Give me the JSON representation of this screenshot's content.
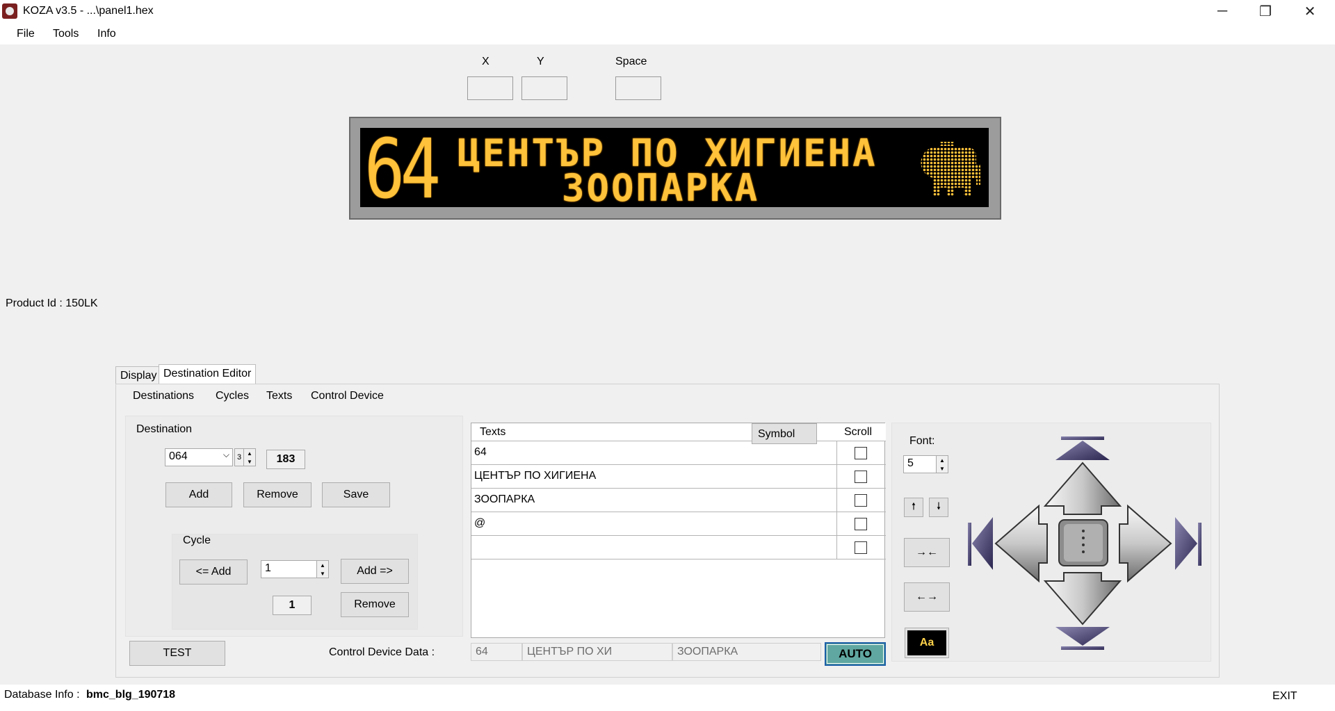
{
  "window": {
    "title": "KOZA  v3.5 - ...\\panel1.hex",
    "minimize": "─",
    "restore": "❐",
    "close": "✕"
  },
  "menu": [
    "File",
    "Tools",
    "Info"
  ],
  "coords": {
    "x_label": "X",
    "y_label": "Y",
    "space_label": "Space",
    "x_value": "",
    "y_value": "",
    "space_value": ""
  },
  "led": {
    "route": "64",
    "line1": "ЦЕНТЪР ПО ХИГИЕНА",
    "line2": "ЗООПАРКА",
    "color": "#ffc23a",
    "icon": "elephant-icon"
  },
  "product": {
    "label": "Product Id :",
    "value": "150LK"
  },
  "tabs": [
    "Display",
    "Destination Editor"
  ],
  "submenu": [
    "Destinations",
    "Cycles",
    "Texts",
    "Control Device"
  ],
  "destination": {
    "group_label": "Destination",
    "select_value": "064",
    "spin_value": "3",
    "code": "183",
    "add": "Add",
    "remove": "Remove",
    "save": "Save"
  },
  "cycle": {
    "group_label": "Cycle",
    "add_left": "<= Add",
    "add_right": "Add =>",
    "spin_value": "1",
    "count": "1",
    "remove": "Remove"
  },
  "texts_grid": {
    "header_texts": "Texts",
    "header_symbol": "Symbol",
    "header_scroll": "Scroll",
    "rows": [
      {
        "text": "64",
        "scroll": false
      },
      {
        "text": "ЦЕНТЪР ПО ХИГИЕНА",
        "scroll": false
      },
      {
        "text": "ЗООПАРКА",
        "scroll": false
      },
      {
        "text": "@",
        "scroll": false
      },
      {
        "text": "",
        "scroll": false
      }
    ]
  },
  "font": {
    "label": "Font:",
    "value": "5",
    "up": "🠕",
    "down": "🠗",
    "compress": "→←",
    "expand": "←→",
    "case": "Aa"
  },
  "test_button": "TEST",
  "control_device": {
    "label": "Control Device Data :",
    "f1": "64",
    "f2": "ЦЕНТЪР ПО ХИ",
    "f3": "ЗООПАРКА",
    "auto": "AUTO",
    "auto_color": "#5fa7a0"
  },
  "status": {
    "db_label": "Database Info :",
    "db_value": "bmc_blg_190718",
    "exit": "EXIT"
  }
}
